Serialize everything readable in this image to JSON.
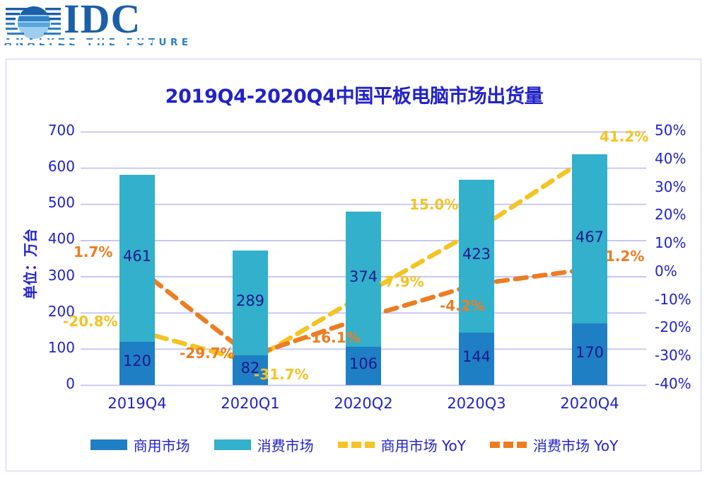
{
  "brand": {
    "name": "IDC",
    "tagline": "ANALYZE THE FUTURE",
    "logo_color": "#1a5fa8"
  },
  "chart_data": {
    "type": "bar",
    "subtype": "stacked-bar-with-lines",
    "title": "2019Q4-2020Q4中国平板电脑市场出货量",
    "xlabel": "",
    "ylabel": "单位：万台",
    "ylabel_right": "",
    "categories": [
      "2019Q4",
      "2020Q1",
      "2020Q2",
      "2020Q3",
      "2020Q4"
    ],
    "ylim": [
      0,
      700
    ],
    "yticks": [
      "0",
      "100",
      "200",
      "300",
      "400",
      "500",
      "600",
      "700"
    ],
    "ylim_right": [
      -40,
      50
    ],
    "yticks_right": [
      "-40%",
      "-30%",
      "-20%",
      "-10%",
      "0%",
      "10%",
      "20%",
      "30%",
      "40%",
      "50%"
    ],
    "grid": true,
    "legend_position": "bottom",
    "series": [
      {
        "name": "商用市场",
        "kind": "bar",
        "color": "#1f7fc4",
        "values": [
          120,
          82,
          106,
          144,
          170
        ],
        "labels": [
          "120",
          "82",
          "106",
          "144",
          "170"
        ]
      },
      {
        "name": "消费市场",
        "kind": "bar",
        "color": "#32b0cc",
        "values": [
          461,
          289,
          374,
          423,
          467
        ],
        "labels": [
          "461",
          "289",
          "374",
          "423",
          "467"
        ]
      },
      {
        "name": "商用市场 YoY",
        "kind": "line",
        "color": "#f5c324",
        "values": [
          -20.8,
          -31.7,
          -7.9,
          15.0,
          41.2
        ],
        "labels": [
          "-20.8%",
          "-31.7%",
          "-7.9%",
          "15.0%",
          "41.2%"
        ]
      },
      {
        "name": "消费市场 YoY",
        "kind": "line",
        "color": "#ed7d22",
        "values": [
          1.7,
          -29.7,
          -16.1,
          -4.2,
          1.2
        ],
        "labels": [
          "1.7%",
          "-29.7%",
          "-16.1%",
          "-4.2%",
          "1.2%"
        ]
      }
    ]
  }
}
